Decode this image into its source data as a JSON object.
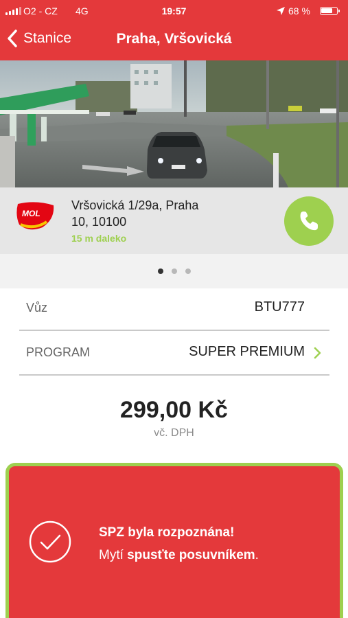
{
  "status_bar": {
    "carrier": "O2 - CZ",
    "network": "4G",
    "time": "19:57",
    "battery_percent": "68 %",
    "battery_level": 0.68
  },
  "nav": {
    "back_label": "Stanice",
    "title": "Praha, Vršovická"
  },
  "station": {
    "brand_logo_text": "MOL",
    "address_line1": "Vršovická 1/29a, Praha",
    "address_line2": "10, 10100",
    "distance": "15 m daleko",
    "call_icon": "phone-icon"
  },
  "carousel": {
    "pages": 3,
    "active_index": 0
  },
  "details": {
    "car_label": "Vůz",
    "car_value": "BTU777",
    "program_label": "PROGRAM",
    "program_value": "SUPER PREMIUM"
  },
  "price": {
    "amount": "299,00 Kč",
    "vat_note": "vč. DPH"
  },
  "notice": {
    "title": "SPZ byla rozpoznána!",
    "text_part1": "Mytí ",
    "text_bold": "spusťte posuvníkem",
    "text_part2": "."
  },
  "colors": {
    "brand_red": "#e4393b",
    "accent_green": "#9ed04f"
  }
}
